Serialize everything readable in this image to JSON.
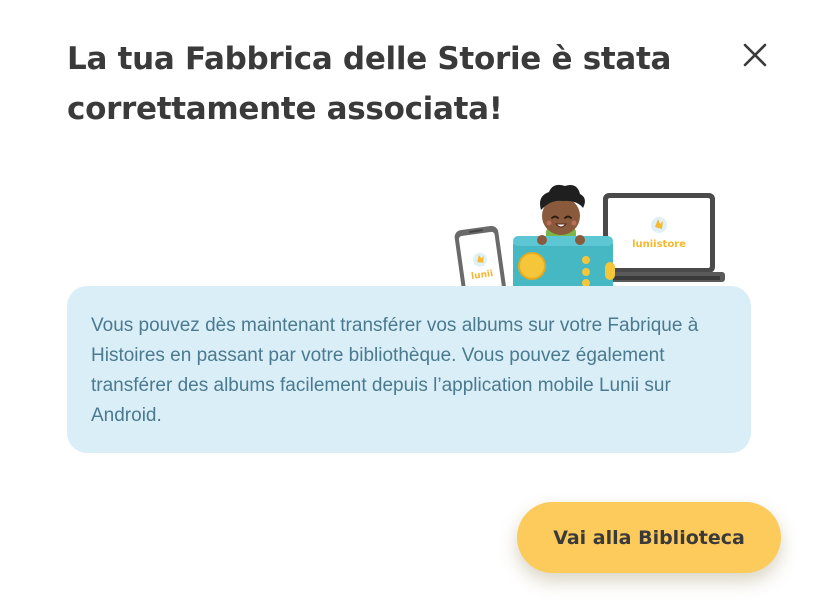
{
  "dialog": {
    "title": "La tua Fabbrica delle Storie è stata correttamente associata!",
    "close_icon": "close-icon",
    "info_text": "Vous pouvez dès maintenant transférer vos albums sur votre Fabrique à Histoires en passant par votre bibliothèque. Vous pouvez également transférer des albums facilement depuis l’application mobile Lunii sur Android.",
    "primary_button_label": "Vai alla Biblioteca"
  },
  "illustration": {
    "phone_app_label": "lunii",
    "laptop_screen_label": "luniistore"
  },
  "colors": {
    "title_text": "#3b3a3a",
    "info_background": "#daeef8",
    "info_text": "#4a7a8f",
    "button_background": "#fccb5b",
    "brand_yellow": "#f5b82e",
    "device_teal": "#45b8c4"
  }
}
